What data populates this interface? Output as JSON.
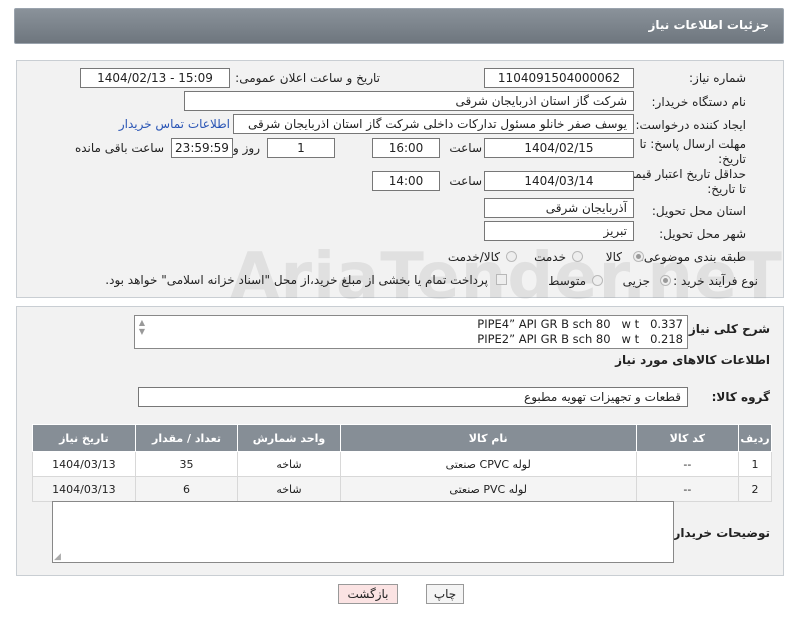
{
  "header": {
    "title": "جزئیات اطلاعات نیاز"
  },
  "form": {
    "need_number_label": "شماره نیاز:",
    "need_number": "1104091504000062",
    "announce_label": "تاریخ و ساعت اعلان عمومی:",
    "announce_value": "1404/02/13 - 15:09",
    "buyer_org_label": "نام دستگاه خریدار:",
    "buyer_org": "شرکت گاز استان اذربایجان شرقی",
    "creator_label": "ایجاد کننده درخواست:",
    "creator": "یوسف صفر خانلو  مسئول تدارکات داخلی  شرکت گاز استان اذربایجان شرقی",
    "contact_link": "اطلاعات تماس خریدار",
    "reply_deadline_label_1": "مهلت ارسال پاسخ: تا",
    "reply_deadline_label_2": "تاریخ:",
    "reply_date": "1404/02/15",
    "time_label": "ساعت",
    "reply_time": "16:00",
    "days_value": "1",
    "days_label": "روز و",
    "remaining_value": "23:59:59",
    "remaining_label": "ساعت باقی مانده",
    "price_deadline_label_1": "حداقل تاریخ اعتبار قیمت:",
    "price_deadline_label_2": "تا تاریخ:",
    "price_date": "1404/03/14",
    "price_time": "14:00",
    "province_label": "استان محل تحویل:",
    "province": "آذربایجان شرقی",
    "city_label": "شهر محل تحویل:",
    "city": "تبریز",
    "category_label": "طبقه بندی موضوعی:",
    "category_options": [
      "کالا",
      "خدمت",
      "کالا/خدمت"
    ],
    "process_label": "نوع فرآیند خرید :",
    "process_options": [
      "جزیی",
      "متوسط"
    ],
    "payment_note": "پرداخت تمام یا بخشی از مبلغ خرید،از محل \"اسناد خزانه اسلامی\" خواهد بود."
  },
  "summary": {
    "label": "شرح کلی نیاز:",
    "lines": [
      "PIPE4” API GR B sch 80   w t   0.337",
      "PIPE2” API GR B sch 80   w t   0.218"
    ]
  },
  "goods": {
    "section_title": "اطلاعات کالاهای مورد نیاز",
    "group_label": "گروه کالا:",
    "group_value": "قطعات و تجهیزات تهویه مطبوع",
    "columns": [
      "ردیف",
      "کد کالا",
      "نام کالا",
      "واحد شمارش",
      "تعداد / مقدار",
      "تاریخ نیاز"
    ],
    "rows": [
      [
        "1",
        "--",
        "لوله CPVC صنعتی",
        "شاخه",
        "35",
        "1404/03/13"
      ],
      [
        "2",
        "--",
        "لوله PVC صنعتی",
        "شاخه",
        "6",
        "1404/03/13"
      ]
    ],
    "buyer_notes_label": "توضیحات خریدار:",
    "buyer_notes": ""
  },
  "buttons": {
    "print": "چاپ",
    "back": "بازگشت"
  },
  "watermark": "AriaTender.neT",
  "colors": {
    "header_bg": "#7b838b",
    "table_header_bg": "#868e96",
    "link": "#2a55b5",
    "back_btn_bg": "#fbe3e3"
  }
}
